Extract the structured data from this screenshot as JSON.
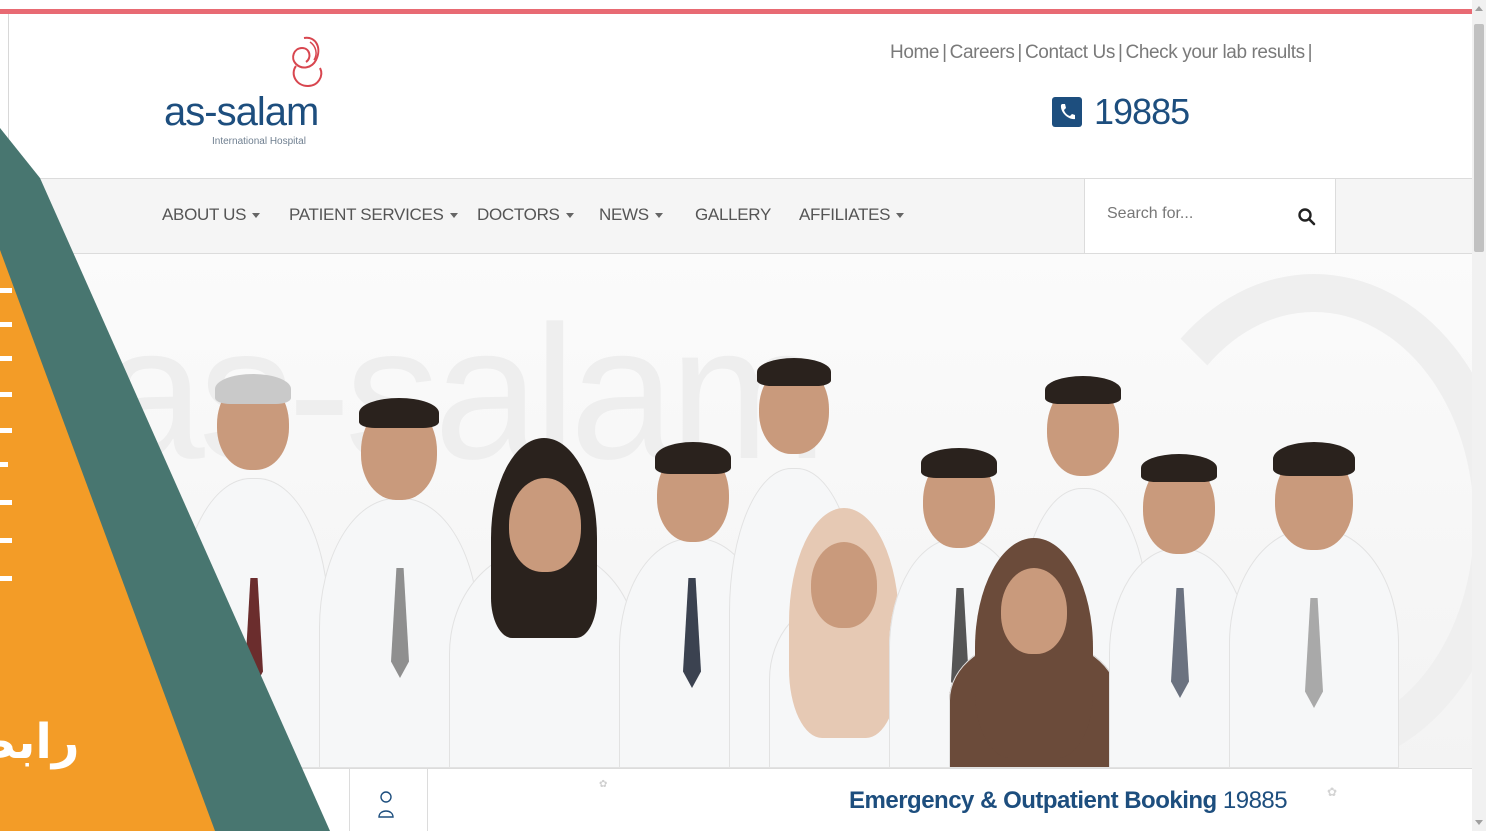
{
  "logo": {
    "name": "as-salam",
    "subtitle": "International Hospital"
  },
  "top_links": [
    "Home",
    "Careers",
    "Contact Us",
    "Check your lab results"
  ],
  "hotline": {
    "number": "19885"
  },
  "nav": {
    "items": [
      {
        "label": "ABOUT US",
        "dropdown": true
      },
      {
        "label": "PATIENT SERVICES",
        "dropdown": true
      },
      {
        "label": "DOCTORS",
        "dropdown": true
      },
      {
        "label": "NEWS",
        "dropdown": true
      },
      {
        "label": "GALLERY",
        "dropdown": false
      },
      {
        "label": "AFFILIATES",
        "dropdown": true
      }
    ],
    "search_placeholder": "Search for..."
  },
  "hero": {
    "watermark": "as-salam"
  },
  "booking": {
    "label": "Emergency & Outpatient Booking",
    "number": "19885"
  },
  "banner": {
    "text": "رابط"
  },
  "colors": {
    "accent_top": "#e86a73",
    "brand_blue": "#1d4e7e",
    "banner_teal": "#487670",
    "banner_orange": "#f39c27"
  }
}
